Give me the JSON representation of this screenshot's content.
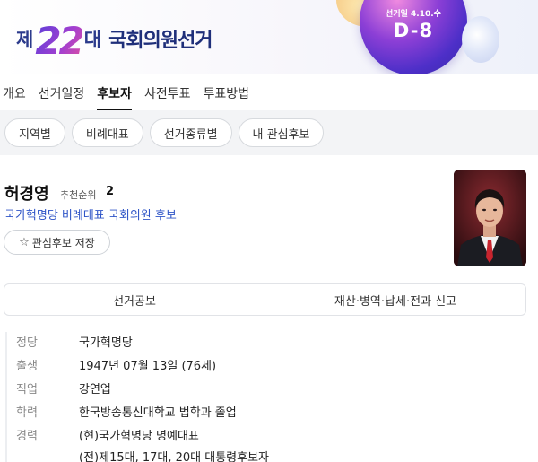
{
  "banner": {
    "logo_prefix": "제",
    "logo_number": "22",
    "logo_suffix": "대",
    "title": "국회의원선거",
    "dday_label": "선거일 4.10.수",
    "dday": "D-8"
  },
  "tabs": [
    {
      "label": "개요",
      "active": false
    },
    {
      "label": "선거일정",
      "active": false
    },
    {
      "label": "후보자",
      "active": true
    },
    {
      "label": "사전투표",
      "active": false
    },
    {
      "label": "투표방법",
      "active": false
    }
  ],
  "filters": [
    "지역별",
    "비례대표",
    "선거종류별",
    "내 관심후보"
  ],
  "candidate": {
    "name": "허경영",
    "rank_label": "추천순위",
    "rank_value": "2",
    "party_line": "국가혁명당 비례대표 국회의원 후보",
    "interest_button": "관심후보 저장",
    "star_icon": "star-icon"
  },
  "subtabs": [
    "선거공보",
    "재산·병역·납세·전과 신고"
  ],
  "info": {
    "party_label": "정당",
    "party_value": "국가혁명당",
    "birth_label": "출생",
    "birth_value": "1947년 07월 13일 (76세)",
    "job_label": "직업",
    "job_value": "강연업",
    "edu_label": "학력",
    "edu_value": "한국방송통신대학교 법학과 졸업",
    "career_label": "경력",
    "career_values": [
      "(현)국가혁명당 명예대표",
      "(전)제15대, 17대, 20대 대통령후보자"
    ]
  },
  "colors": {
    "accent_blue": "#2f55c7",
    "orb_purple": "#6a35d0",
    "filter_bg": "#f3f4f6"
  }
}
